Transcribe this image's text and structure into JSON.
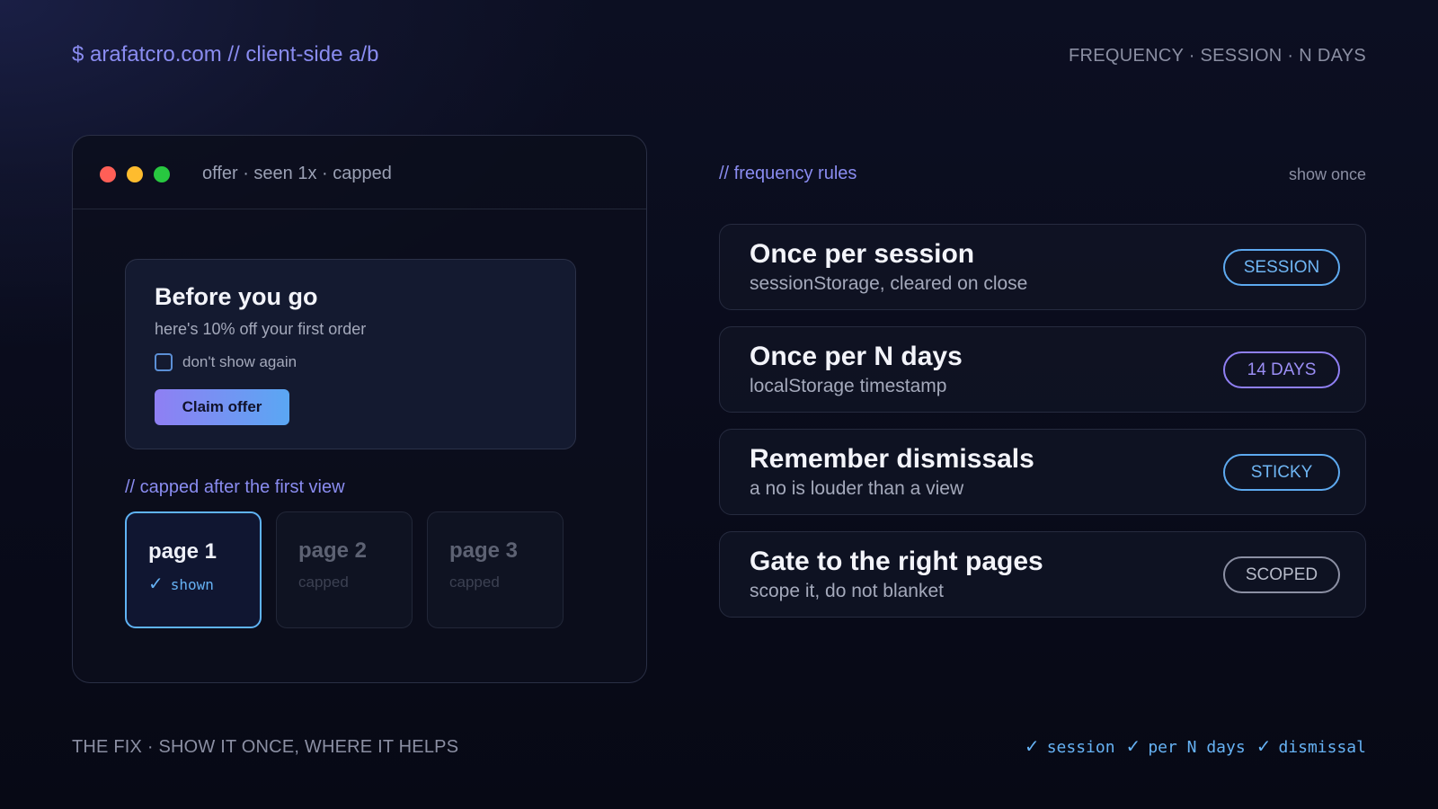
{
  "header": {
    "brand": "$ arafatcro.com // client-side a/b",
    "tagline": "FREQUENCY · SESSION · N DAYS"
  },
  "window": {
    "title": "offer · seen 1x · capped",
    "offer": {
      "title": "Before you go",
      "subtitle": "here's 10% off your first order",
      "checkbox_label": "don't show again",
      "checkbox_checked": false,
      "button_label": "Claim offer"
    },
    "capped_note": "// capped after the first view",
    "pages": [
      {
        "name": "page 1",
        "status": "shown",
        "active": true
      },
      {
        "name": "page 2",
        "status": "capped",
        "active": false
      },
      {
        "name": "page 3",
        "status": "capped",
        "active": false
      }
    ]
  },
  "rules": {
    "heading": "// frequency rules",
    "aside": "show once",
    "items": [
      {
        "title": "Once per session",
        "subtitle": "sessionStorage, cleared on close",
        "badge": "SESSION",
        "badge_color": "#5da9ef"
      },
      {
        "title": "Once per N days",
        "subtitle": "localStorage timestamp",
        "badge": "14 DAYS",
        "badge_color": "#8f7ff3"
      },
      {
        "title": "Remember dismissals",
        "subtitle": "a no is louder than a view",
        "badge": "STICKY",
        "badge_color": "#5da9ef"
      },
      {
        "title": "Gate to the right pages",
        "subtitle": "scope it, do not blanket",
        "badge": "SCOPED",
        "badge_color": "#8b8fa3"
      }
    ]
  },
  "footer": {
    "left": "THE FIX · SHOW IT ONCE, WHERE IT HELPS",
    "checks": [
      "session",
      "per N days",
      "dismissal"
    ]
  },
  "icons": {
    "check": "✓"
  }
}
